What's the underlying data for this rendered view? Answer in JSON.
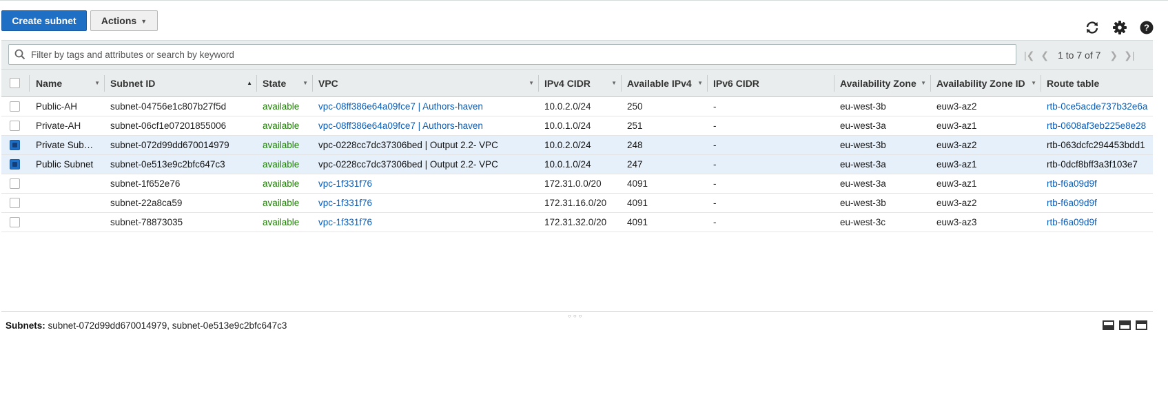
{
  "toolbar": {
    "create_label": "Create subnet",
    "actions_label": "Actions",
    "refresh_icon": "refresh-icon",
    "settings_icon": "gear-icon",
    "help_icon": "help-icon"
  },
  "filter": {
    "placeholder": "Filter by tags and attributes or search by keyword",
    "value": ""
  },
  "pagination": {
    "text": "1 to 7 of 7"
  },
  "columns": [
    "Name",
    "Subnet ID",
    "State",
    "VPC",
    "IPv4 CIDR",
    "Available IPv4",
    "IPv6 CIDR",
    "Availability Zone",
    "Availability Zone ID",
    "Route table"
  ],
  "rows": [
    {
      "checked": false,
      "name": "Public-AH",
      "subnet_id": "subnet-04756e1c807b27f5d",
      "state": "available",
      "vpc": "vpc-08ff386e64a09fce7 | Authors-haven",
      "ipv4": "10.0.2.0/24",
      "avail": "250",
      "ipv6": "-",
      "az": "eu-west-3b",
      "azid": "euw3-az2",
      "rt": "rtb-0ce5acde737b32e6a"
    },
    {
      "checked": false,
      "name": "Private-AH",
      "subnet_id": "subnet-06cf1e07201855006",
      "state": "available",
      "vpc": "vpc-08ff386e64a09fce7 | Authors-haven",
      "ipv4": "10.0.1.0/24",
      "avail": "251",
      "ipv6": "-",
      "az": "eu-west-3a",
      "azid": "euw3-az1",
      "rt": "rtb-0608af3eb225e8e28"
    },
    {
      "checked": true,
      "name": "Private Sub…",
      "subnet_id": "subnet-072d99dd670014979",
      "state": "available",
      "vpc": "vpc-0228cc7dc37306bed | Output 2.2- VPC",
      "ipv4": "10.0.2.0/24",
      "avail": "248",
      "ipv6": "-",
      "az": "eu-west-3b",
      "azid": "euw3-az2",
      "rt": "rtb-063dcfc294453bdd1"
    },
    {
      "checked": true,
      "name": "Public Subnet",
      "subnet_id": "subnet-0e513e9c2bfc647c3",
      "state": "available",
      "vpc": "vpc-0228cc7dc37306bed | Output 2.2- VPC",
      "ipv4": "10.0.1.0/24",
      "avail": "247",
      "ipv6": "-",
      "az": "eu-west-3a",
      "azid": "euw3-az1",
      "rt": "rtb-0dcf8bff3a3f103e7"
    },
    {
      "checked": false,
      "name": "",
      "subnet_id": "subnet-1f652e76",
      "state": "available",
      "vpc": "vpc-1f331f76",
      "ipv4": "172.31.0.0/20",
      "avail": "4091",
      "ipv6": "-",
      "az": "eu-west-3a",
      "azid": "euw3-az1",
      "rt": "rtb-f6a09d9f"
    },
    {
      "checked": false,
      "name": "",
      "subnet_id": "subnet-22a8ca59",
      "state": "available",
      "vpc": "vpc-1f331f76",
      "ipv4": "172.31.16.0/20",
      "avail": "4091",
      "ipv6": "-",
      "az": "eu-west-3b",
      "azid": "euw3-az2",
      "rt": "rtb-f6a09d9f"
    },
    {
      "checked": false,
      "name": "",
      "subnet_id": "subnet-78873035",
      "state": "available",
      "vpc": "vpc-1f331f76",
      "ipv4": "172.31.32.0/20",
      "avail": "4091",
      "ipv6": "-",
      "az": "eu-west-3c",
      "azid": "euw3-az3",
      "rt": "rtb-f6a09d9f"
    }
  ],
  "details": {
    "label": "Subnets:",
    "value": "subnet-072d99dd670014979, subnet-0e513e9c2bfc647c3"
  },
  "colors": {
    "primary": "#1f6fc5",
    "link": "#0a5db7",
    "available": "#1d8102",
    "selected_row": "#e6f0fa"
  }
}
